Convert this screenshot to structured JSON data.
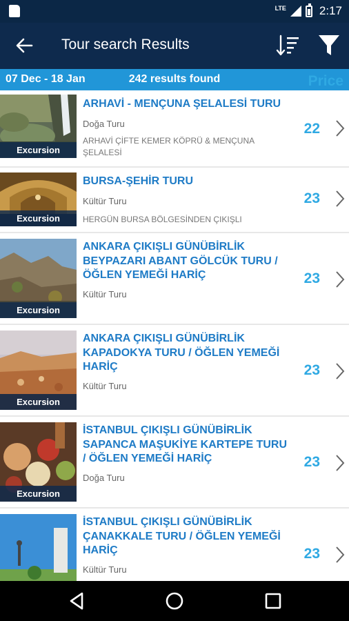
{
  "status_bar": {
    "network": "LTE",
    "time": "2:17"
  },
  "app_bar": {
    "title": "Tour search Results"
  },
  "info_bar": {
    "dates": "07 Dec - 18 Jan",
    "results": "242 results found",
    "price_label": "Price USD"
  },
  "colors": {
    "app_bar_bg": "#0e2a4d",
    "info_bar_bg": "#2196d8",
    "title_blue": "#1e7bc6",
    "price_blue": "#2fa9e3"
  },
  "tours": [
    {
      "name": "ARHAVİ - MENÇUNA ŞELALESİ TURU",
      "category": "Doğa Turu",
      "description": "ARHAVİ ÇİFTE KEMER KÖPRÜ & MENÇUNA ŞELALESİ",
      "price": "22",
      "badge": "Excursion",
      "image": "waterfall-photo"
    },
    {
      "name": "BURSA-ŞEHİR TURU",
      "category": "Kültür Turu",
      "description": "HERGÜN BURSA BÖLGESİNDEN ÇIKIŞLI",
      "price": "23",
      "badge": "Excursion",
      "image": "mosque-interior-photo"
    },
    {
      "name": "ANKARA ÇIKIŞLI GÜNÜBİRLİK BEYPAZARI ABANT GÖLCÜK TURU / ÖĞLEN YEMEĞİ HARİÇ",
      "category": "Kültür Turu",
      "description": "",
      "price": "23",
      "badge": "Excursion",
      "image": "town-hillside-photo"
    },
    {
      "name": "ANKARA ÇIKIŞLI GÜNÜBİRLİK KAPADOKYA TURU / ÖĞLEN YEMEĞİ HARİÇ",
      "category": "Kültür Turu",
      "description": "",
      "price": "23",
      "badge": "Excursion",
      "image": "cappadocia-photo"
    },
    {
      "name": "İSTANBUL ÇIKIŞLI GÜNÜBİRLİK SAPANCA MAŞUKİYE KARTEPE TURU / ÖĞLEN YEMEĞİ HARİÇ",
      "category": "Doğa Turu",
      "description": "",
      "price": "23",
      "badge": "Excursion",
      "image": "breakfast-table-photo"
    },
    {
      "name": "İSTANBUL ÇIKIŞLI GÜNÜBİRLİK ÇANAKKALE TURU / ÖĞLEN YEMEĞİ HARİÇ",
      "category": "Kültür Turu",
      "description": "",
      "price": "23",
      "badge": "",
      "image": "monument-photo"
    }
  ],
  "nav_bar": {
    "buttons": [
      "back-triangle-icon",
      "home-circle-icon",
      "recents-square-icon"
    ]
  }
}
